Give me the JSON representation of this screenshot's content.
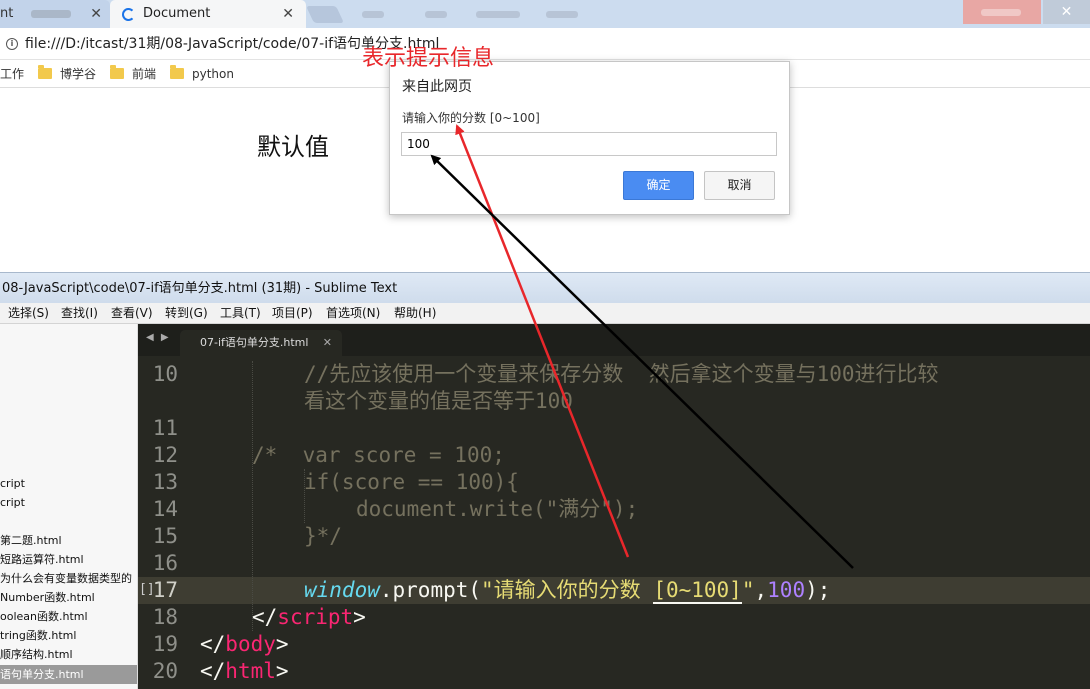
{
  "browser": {
    "tabs": [
      {
        "label": "nt",
        "close": "✕"
      },
      {
        "label": "Document",
        "close": "✕"
      }
    ],
    "address": {
      "url": "file:///D:/itcast/31期/08-JavaScript/code/07-if语句单分支.html"
    },
    "bookmarks": [
      "工作",
      "博学谷",
      "前端",
      "python"
    ],
    "page": {
      "default_text": "默认值"
    },
    "dialog": {
      "title": "来自此网页",
      "message": "请输入你的分数 [0~100]",
      "input_value": "100",
      "ok_label": "确定",
      "cancel_label": "取消"
    },
    "annotation": {
      "label": "表示提示信息",
      "color": "#e8272b"
    }
  },
  "sublime": {
    "title": "08-JavaScript\\code\\07-if语句单分支.html (31期) - Sublime Text",
    "menu": [
      "选择(S)",
      "查找(I)",
      "查看(V)",
      "转到(G)",
      "工具(T)",
      "项目(P)",
      "首选项(N)",
      "帮助(H)"
    ],
    "sidebar_files": [
      "cript",
      "cript",
      "第二题.html",
      "短路运算符.html",
      "为什么会有变量数据类型的",
      "Number函数.html",
      "oolean函数.html",
      "tring函数.html",
      "顺序结构.html",
      "语句单分支.html"
    ],
    "tab": {
      "label": "07-if语句单分支.html",
      "close": "✕",
      "nav": "◀ ▶"
    },
    "gutter": [
      "10",
      "",
      "11",
      "12",
      "13",
      "14",
      "15",
      "16",
      "17",
      "18",
      "19",
      "20"
    ],
    "bookmark_marker": "[]",
    "code": {
      "l10a": "//先应该使用一个变量来保存分数  然后拿这个变量与100进行比较",
      "l10b": "看这个变量的值是否等于100",
      "l12_open": "/*",
      "l12_rest": "  var score = 100;",
      "l13": "if(score == 100){",
      "l14": "document.write(\"满分\");",
      "l15": "}*/",
      "l17_obj": "window",
      "l17_dot": ".",
      "l17_fn": "prompt(",
      "l17_str_a": "\"请输入你的分数 ",
      "l17_str_b": "[0~100]",
      "l17_str_c": "\"",
      "l17_comma": ",",
      "l17_num": "100",
      "l17_end": ");",
      "l18_lt": "</",
      "l18_tag": "script",
      "l18_gt": ">",
      "l19_lt": "</",
      "l19_tag": "body",
      "l19_gt": ">",
      "l20_lt": "</",
      "l20_tag": "html",
      "l20_gt": ">"
    }
  }
}
